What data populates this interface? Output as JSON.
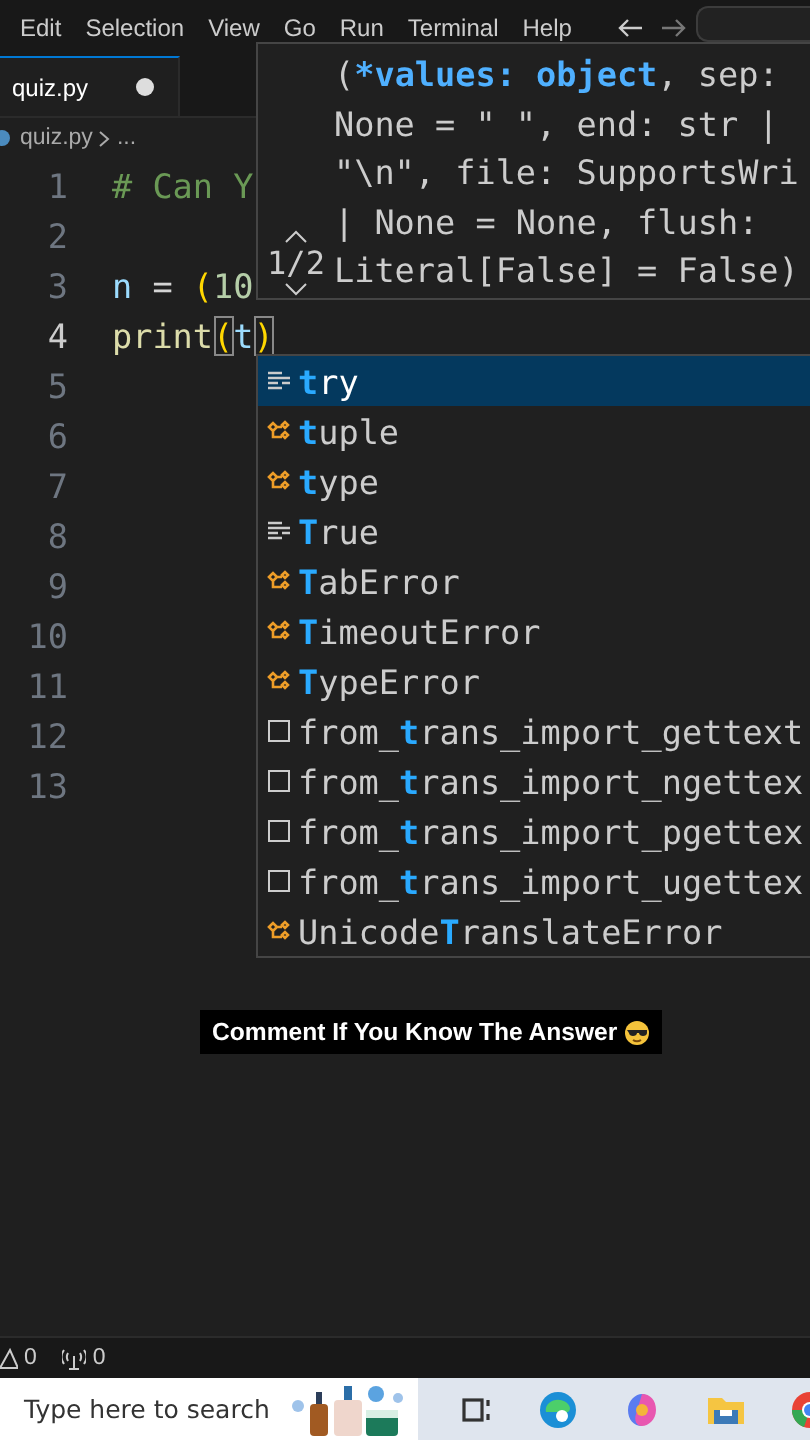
{
  "menu": [
    "Edit",
    "Selection",
    "View",
    "Go",
    "Run",
    "Terminal",
    "Help"
  ],
  "tabs": [
    {
      "label": "quiz.py",
      "selected": true,
      "modified": true
    }
  ],
  "breadcrumb": [
    "quiz.py",
    "..."
  ],
  "code_lines": [
    {
      "number": "1",
      "tokens": [
        {
          "text": "# Can Y",
          "kind": "comment"
        }
      ]
    },
    {
      "number": "2"
    },
    {
      "number": "3",
      "tokens": [
        {
          "text": "n",
          "kind": "variable"
        },
        {
          "text": " = ",
          "kind": "operator"
        },
        {
          "text": "(",
          "kind": "bracket"
        },
        {
          "text": "10",
          "kind": "number"
        }
      ]
    },
    {
      "number": "4",
      "current": true,
      "tokens": [
        {
          "text": "print",
          "kind": "function"
        },
        {
          "text": "(",
          "kind": "bracket",
          "matched": true
        },
        {
          "text": "t",
          "kind": "variable"
        },
        {
          "text": ")",
          "kind": "bracket",
          "matched": true
        }
      ]
    },
    {
      "number": "5"
    },
    {
      "number": "6"
    },
    {
      "number": "7"
    },
    {
      "number": "8"
    },
    {
      "number": "9"
    },
    {
      "number": "10"
    },
    {
      "number": "11"
    },
    {
      "number": "12"
    },
    {
      "number": "13"
    }
  ],
  "parameter_hint": {
    "counter": "1/2",
    "lines": [
      {
        "before": "(",
        "active": "*values: object",
        "after": ", sep:"
      },
      {
        "before": "None = \" \", end: str |"
      },
      {
        "before": "\"\\n\", file: SupportsWri"
      },
      {
        "before": "| None = None, flush:"
      },
      {
        "before": "Literal[False] = False)"
      }
    ]
  },
  "suggestions": [
    {
      "kind": "keyword",
      "match": "t",
      "after": "ry",
      "selected": true
    },
    {
      "kind": "class",
      "match": "t",
      "after": "uple",
      "selected": false
    },
    {
      "kind": "class",
      "match": "t",
      "after": "ype",
      "selected": false
    },
    {
      "kind": "keyword",
      "match": "T",
      "after": "rue",
      "selected": false
    },
    {
      "kind": "class",
      "match": "T",
      "after": "abError",
      "selected": false
    },
    {
      "kind": "class",
      "match": "T",
      "after": "imeoutError",
      "selected": false
    },
    {
      "kind": "class",
      "match": "T",
      "after": "ypeError",
      "selected": false
    },
    {
      "kind": "text",
      "before": "from_",
      "match": "t",
      "after": "rans_import_gettext",
      "selected": false
    },
    {
      "kind": "text",
      "before": "from_",
      "match": "t",
      "after": "rans_import_ngettex",
      "selected": false
    },
    {
      "kind": "text",
      "before": "from_",
      "match": "t",
      "after": "rans_import_pgettex",
      "selected": false
    },
    {
      "kind": "text",
      "before": "from_",
      "match": "t",
      "after": "rans_import_ugettex",
      "selected": false
    },
    {
      "kind": "class",
      "before": "Unicode",
      "match": "T",
      "after": "ranslateError",
      "selected": false
    }
  ],
  "caption": "Comment If You Know The Answer",
  "status_bar": {
    "warnings": "0",
    "ports": "0"
  },
  "taskbar": {
    "search_placeholder": "Type here to search"
  }
}
